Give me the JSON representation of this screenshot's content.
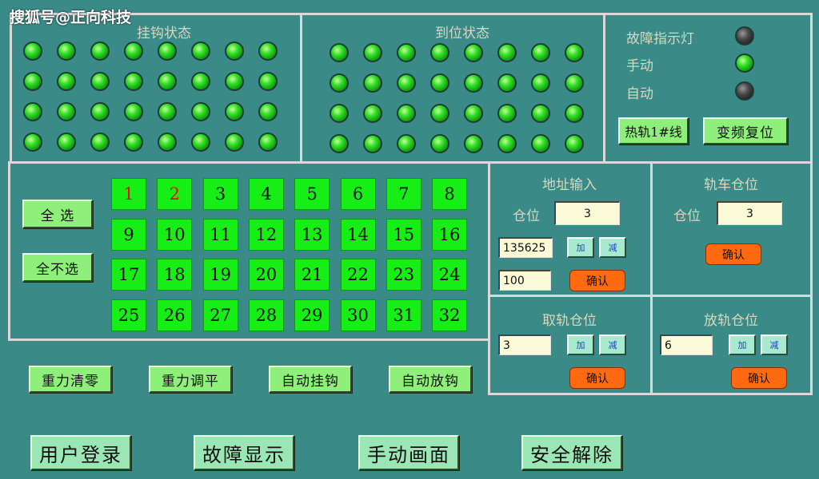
{
  "watermark": "搜狐号@正向科技",
  "hook_status": {
    "title": "挂钩状态",
    "leds": [
      true,
      true,
      true,
      true,
      true,
      true,
      true,
      true,
      true,
      true,
      true,
      true,
      true,
      true,
      true,
      true,
      true,
      true,
      true,
      true,
      true,
      true,
      true,
      true,
      true,
      true,
      true,
      true,
      true,
      true,
      true,
      true
    ]
  },
  "position_status": {
    "title": "到位状态",
    "leds": [
      true,
      true,
      true,
      true,
      true,
      true,
      true,
      true,
      true,
      true,
      true,
      true,
      true,
      true,
      true,
      true,
      true,
      true,
      true,
      true,
      true,
      true,
      true,
      true,
      true,
      true,
      true,
      true,
      true,
      true,
      true,
      true
    ]
  },
  "indicators": {
    "fault_label": "故障指示灯",
    "fault_on": false,
    "manual_label": "手动",
    "manual_on": true,
    "auto_label": "自动",
    "auto_on": false,
    "rail_button": "热轨1#线",
    "vfd_reset_button": "变频复位"
  },
  "selection": {
    "select_all": "全 选",
    "select_none": "全不选",
    "numbers": [
      "1",
      "2",
      "3",
      "4",
      "5",
      "6",
      "7",
      "8",
      "9",
      "10",
      "11",
      "12",
      "13",
      "14",
      "15",
      "16",
      "17",
      "18",
      "19",
      "20",
      "21",
      "22",
      "23",
      "24",
      "25",
      "26",
      "27",
      "28",
      "29",
      "30",
      "31",
      "32"
    ],
    "red_numbers": [
      "1",
      "2"
    ]
  },
  "address_input": {
    "title": "地址输入",
    "slot_label": "仓位",
    "slot_value": "3",
    "value1": "135625",
    "add": "加",
    "sub": "减",
    "value2": "100",
    "confirm": "确认"
  },
  "rail_car_slot": {
    "title": "轨车仓位",
    "slot_label": "仓位",
    "slot_value": "3",
    "confirm": "确认"
  },
  "take_rail_slot": {
    "title": "取轨仓位",
    "value": "3",
    "add": "加",
    "sub": "减",
    "confirm": "确认"
  },
  "put_rail_slot": {
    "title": "放轨仓位",
    "value": "6",
    "add": "加",
    "sub": "减",
    "confirm": "确认"
  },
  "actions": {
    "gravity_zero": "重力清零",
    "gravity_level": "重力调平",
    "auto_hook": "自动挂钩",
    "auto_unhook": "自动放钩"
  },
  "bottom_nav": {
    "login": "用户登录",
    "fault_display": "故障显示",
    "manual_screen": "手动画面",
    "safety_release": "安全解除"
  }
}
